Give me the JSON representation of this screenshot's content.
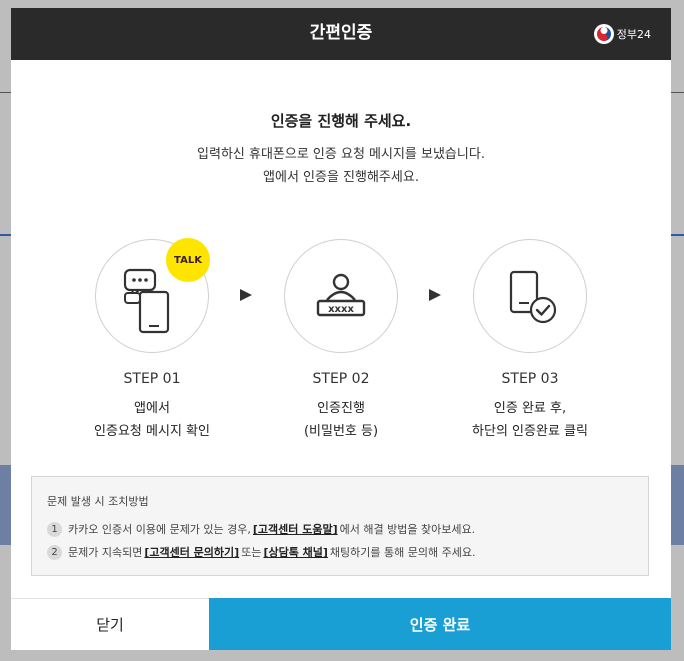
{
  "modal": {
    "title": "간편인증",
    "logo_text": "정부24"
  },
  "intro": {
    "headline": "인증을 진행해 주세요.",
    "desc_line1": "입력하신 휴대폰으로 인증 요청 메시지를 보냈습니다.",
    "desc_line2": "앱에서 인증을 진행해주세요."
  },
  "steps": [
    {
      "label": "STEP 01",
      "desc_line1": "앱에서",
      "desc_line2": "인증요청 메시지 확인",
      "icon": "phone-chat-icon",
      "badge": "TALK"
    },
    {
      "label": "STEP 02",
      "desc_line1": "인증진행",
      "desc_line2": "(비밀번호 등)",
      "icon": "user-password-icon",
      "pw_mask": "xxxx"
    },
    {
      "label": "STEP 03",
      "desc_line1": "인증 완료 후,",
      "desc_line2": "하단의 인증완료 클릭",
      "icon": "phone-check-icon"
    }
  ],
  "notice": {
    "title": "문제 발생 시 조치방법",
    "items": [
      {
        "num": "1",
        "pre": "카카오 인증서 이용에 문제가 있는 경우,",
        "link1": "[고객센터 도움말]",
        "post": "에서 해결 방법을 찾아보세요."
      },
      {
        "num": "2",
        "pre": "문제가 지속되면",
        "link1": "[고객센터 문의하기]",
        "mid": "또는",
        "link2": "[상담톡 채널]",
        "post": "채팅하기를 통해 문의해 주세요."
      }
    ]
  },
  "buttons": {
    "close": "닫기",
    "complete": "인증 완료"
  },
  "colors": {
    "header_bg": "#2a2a2a",
    "primary": "#1a9fd5",
    "kakao_yellow": "#fee500"
  }
}
